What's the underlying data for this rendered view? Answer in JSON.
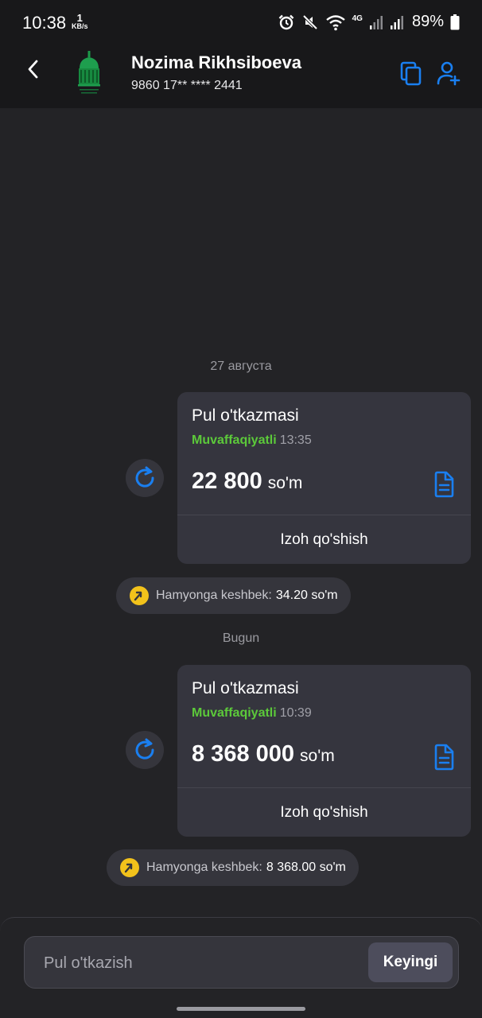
{
  "status_bar": {
    "time": "10:38",
    "net_speed_value": "1",
    "net_speed_unit": "KB/s",
    "network_type": "4G",
    "battery": "89%"
  },
  "header": {
    "contact_name": "Nozima Rikhsiboeva",
    "card_number": "9860 17** **** 2441"
  },
  "messages": [
    {
      "date": "27 августа",
      "title": "Pul o'tkazmasi",
      "status": "Muvaffaqiyatli",
      "time": "13:35",
      "amount": "22 800",
      "currency": "so'm",
      "comment_label": "Izoh qo'shish",
      "cashback_label": "Hamyonga keshbek:",
      "cashback_value": "34.20 so'm"
    },
    {
      "date": "Bugun",
      "title": "Pul o'tkazmasi",
      "status": "Muvaffaqiyatli",
      "time": "10:39",
      "amount": "8 368 000",
      "currency": "so'm",
      "comment_label": "Izoh qo'shish",
      "cashback_label": "Hamyonga keshbek:",
      "cashback_value": "8 368.00 so'm"
    }
  ],
  "transfer": {
    "placeholder": "Pul o'tkazish",
    "next_label": "Keyingi"
  },
  "colors": {
    "accent": "#1a7ff0",
    "success": "#5cc93a",
    "cashback_coin": "#f2c21b"
  }
}
